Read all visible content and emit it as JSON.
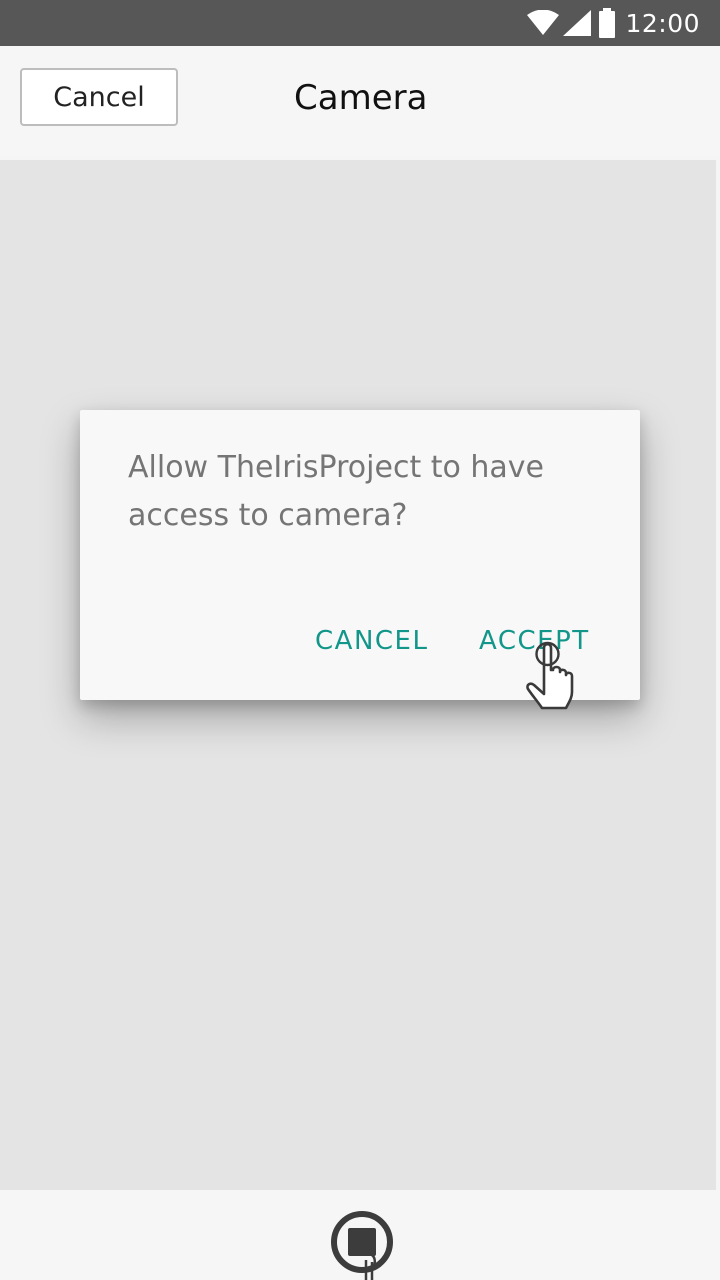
{
  "status_bar": {
    "time": "12:00",
    "icons": [
      "wifi-icon",
      "cell-signal-icon",
      "battery-icon"
    ]
  },
  "header": {
    "cancel_label": "Cancel",
    "title": "Camera"
  },
  "dialog": {
    "message": "Allow TheIrisProject to have access to camera?",
    "cancel_label": "CANCEL",
    "accept_label": "ACCEPT",
    "button_color": "#12968a"
  },
  "bottom_bar": {
    "shutter_icon": "stop-record-icon",
    "pointer_icon": "hand-pointer-icon"
  }
}
